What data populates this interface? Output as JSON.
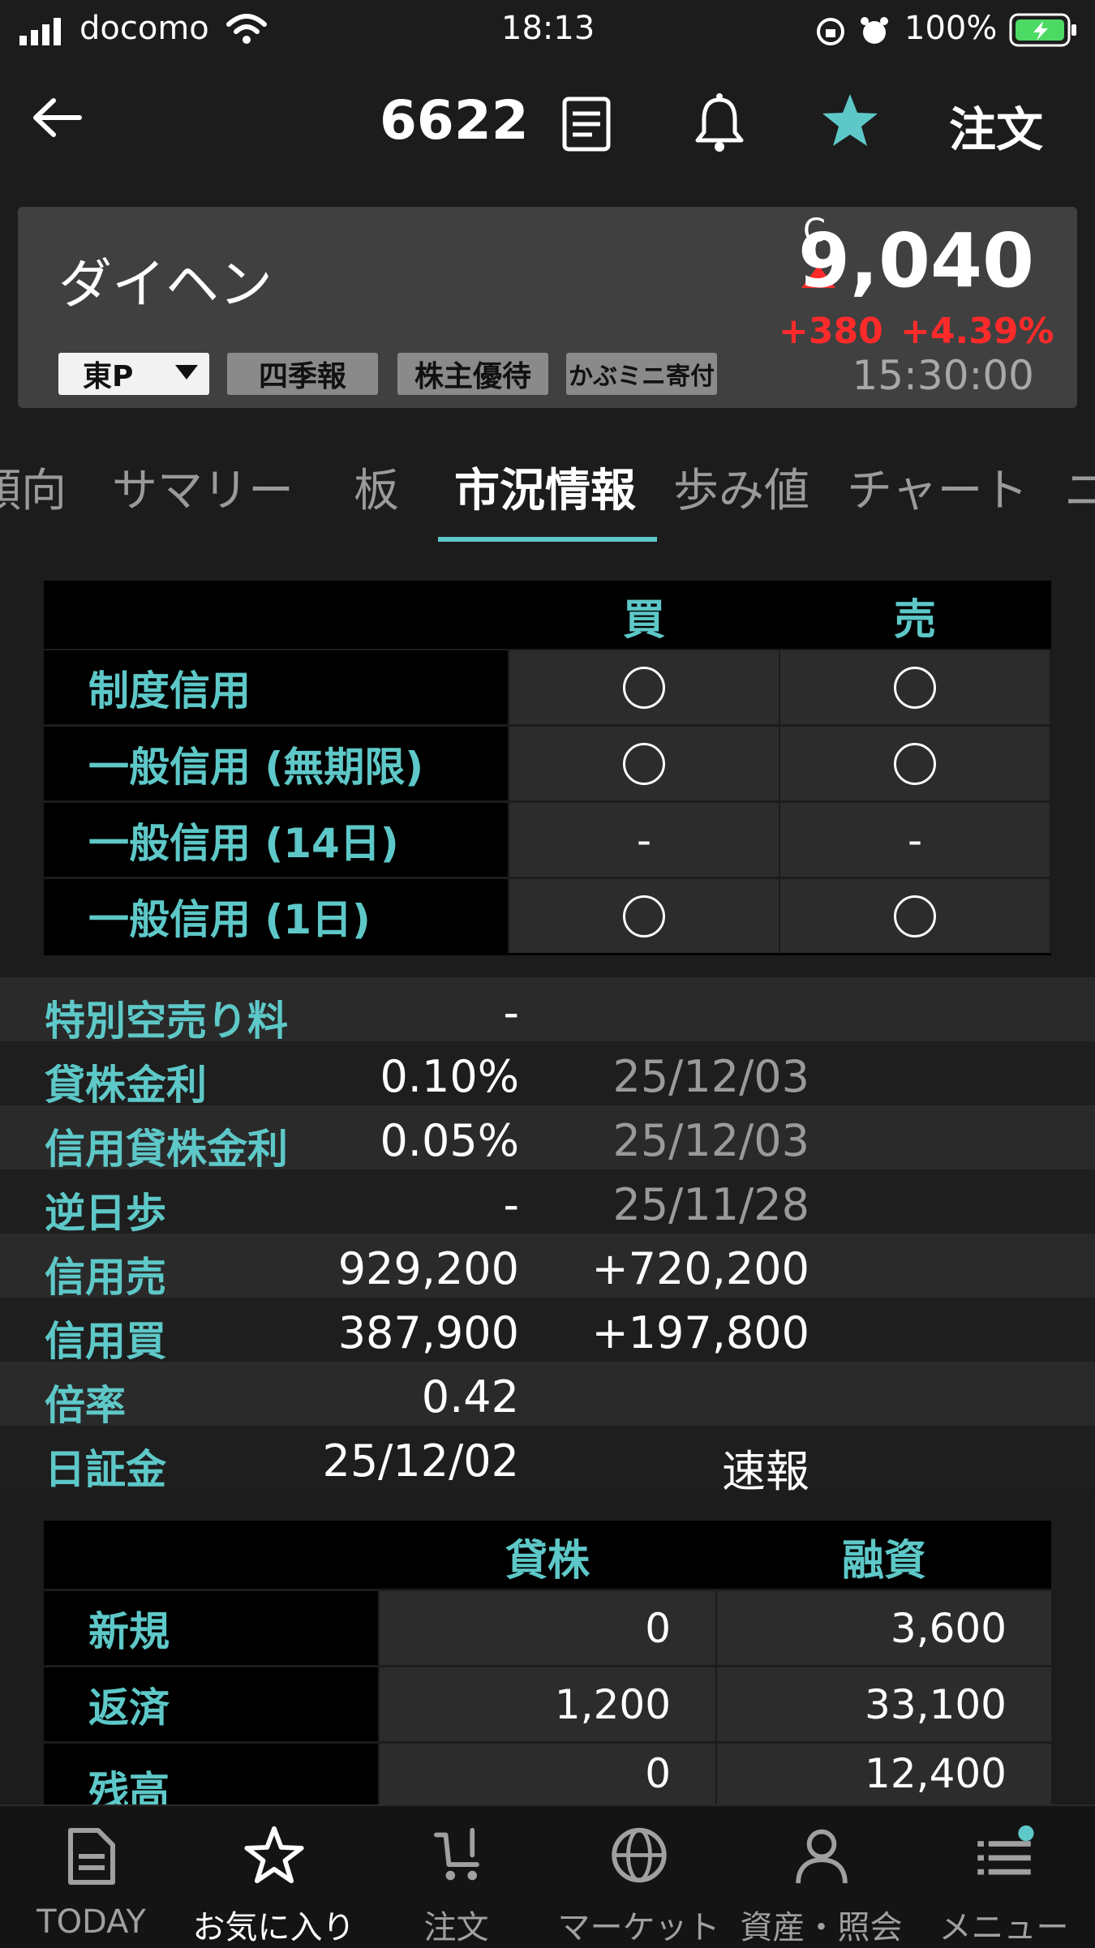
{
  "status": {
    "carrier": "docomo",
    "time": "18:13",
    "battery": "100%"
  },
  "nav": {
    "code": "6622",
    "order": "注文"
  },
  "stock": {
    "name": "ダイヘン",
    "market": "東P",
    "tags": [
      "四季報",
      "株主優待",
      "かぶミニ寄付"
    ],
    "price_flag": "C",
    "price": "9,040",
    "change": "+380",
    "change_pct": "+4.39%",
    "time": "15:30:00"
  },
  "tabs": [
    "傾向",
    "サマリー",
    "板",
    "市況情報",
    "歩み値",
    "チャート",
    "ニ"
  ],
  "margin_table": {
    "headers": [
      "買",
      "売"
    ],
    "rows": [
      {
        "label": "制度信用",
        "buy": "○",
        "sell": "○"
      },
      {
        "label": "一般信用 (無期限)",
        "buy": "○",
        "sell": "○"
      },
      {
        "label": "一般信用 (14日)",
        "buy": "-",
        "sell": "-"
      },
      {
        "label": "一般信用 (1日)",
        "buy": "○",
        "sell": "○"
      }
    ]
  },
  "info": [
    {
      "label": "特別空売り料",
      "value": "-",
      "extra": ""
    },
    {
      "label": "貸株金利",
      "value": "0.10%",
      "extra": "25/12/03"
    },
    {
      "label": "信用貸株金利",
      "value": "0.05%",
      "extra": "25/12/03"
    },
    {
      "label": "逆日歩",
      "value": "-",
      "extra": "25/11/28"
    },
    {
      "label": "信用売",
      "value": "929,200",
      "extra": "+720,200"
    },
    {
      "label": "信用買",
      "value": "387,900",
      "extra": "+197,800"
    },
    {
      "label": "倍率",
      "value": "0.42",
      "extra": ""
    },
    {
      "label": "日証金",
      "value": "25/12/02",
      "extra": "速報"
    }
  ],
  "lending_table": {
    "headers": [
      "貸株",
      "融資"
    ],
    "rows": [
      {
        "label": "新規",
        "a": "0",
        "b": "3,600"
      },
      {
        "label": "返済",
        "a": "1,200",
        "b": "33,100"
      },
      {
        "label": "残高",
        "a": "0",
        "b": "12,400"
      }
    ]
  },
  "bottom_nav": [
    {
      "label": "TODAY",
      "icon": "document-icon"
    },
    {
      "label": "お気に入り",
      "icon": "star-outline-icon"
    },
    {
      "label": "注文",
      "icon": "cart-icon"
    },
    {
      "label": "マーケット",
      "icon": "globe-icon"
    },
    {
      "label": "資産・照会",
      "icon": "person-icon"
    },
    {
      "label": "メニュー",
      "icon": "menu-icon"
    }
  ],
  "colors": {
    "accent": "#5ec8c8",
    "up": "#ff2a2a",
    "background": "#1c1c1c"
  }
}
